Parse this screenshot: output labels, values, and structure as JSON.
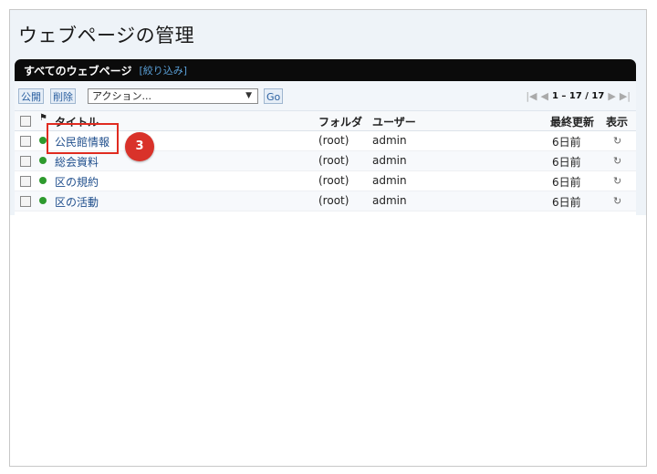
{
  "page": {
    "title": "ウェブページの管理"
  },
  "bar": {
    "title": "すべてのウェブページ",
    "filter": "[絞り込み]"
  },
  "toolbar": {
    "publish": "公開",
    "delete": "削除",
    "action_select": "アクション...",
    "go": "Go",
    "pager_range": "1 – 17 / 17"
  },
  "table": {
    "headers": {
      "title": "タイトル",
      "folder": "フォルダ",
      "user": "ユーザー",
      "updated": "最終更新",
      "view": "表示"
    },
    "rows": [
      {
        "title": "公民館情報",
        "folder": "(root)",
        "user": "admin",
        "updated": "6日前"
      },
      {
        "title": "総会資料",
        "folder": "(root)",
        "user": "admin",
        "updated": "6日前"
      },
      {
        "title": "区の規約",
        "folder": "(root)",
        "user": "admin",
        "updated": "6日前"
      },
      {
        "title": "区の活動",
        "folder": "(root)",
        "user": "admin",
        "updated": "6日前"
      }
    ]
  },
  "callout": {
    "number": "3"
  },
  "colors": {
    "bar": "#0b0b0b",
    "status": "#2e9a2e",
    "callout": "#d9322a"
  }
}
